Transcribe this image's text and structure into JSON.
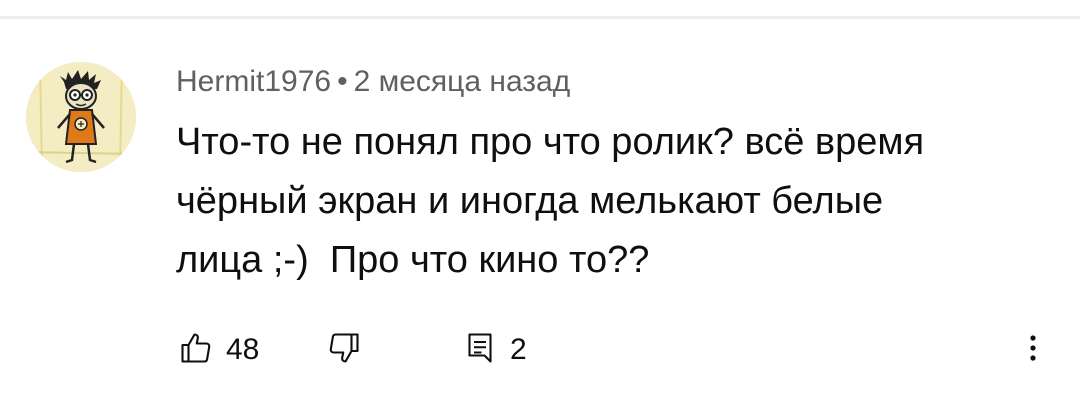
{
  "comment": {
    "author": "Hermit1976",
    "separator": "•",
    "time": "2 месяца назад",
    "text_lines": [
      "Что-то не понял про что ролик? всё время",
      "чёрный экран и иногда мелькают белые",
      "лица ;-)  Про что кино то??"
    ],
    "likes": "48",
    "replies": "2"
  },
  "icons": {
    "like": "thumbs-up-icon",
    "dislike": "thumbs-down-icon",
    "reply": "comment-icon",
    "more": "vertical-dots-icon"
  },
  "colors": {
    "text": "#0f0f0f",
    "meta": "#606060",
    "divider": "#eeeeee",
    "avatar_bg": "#f3e9b9",
    "avatar_accent": "#e07a18"
  }
}
